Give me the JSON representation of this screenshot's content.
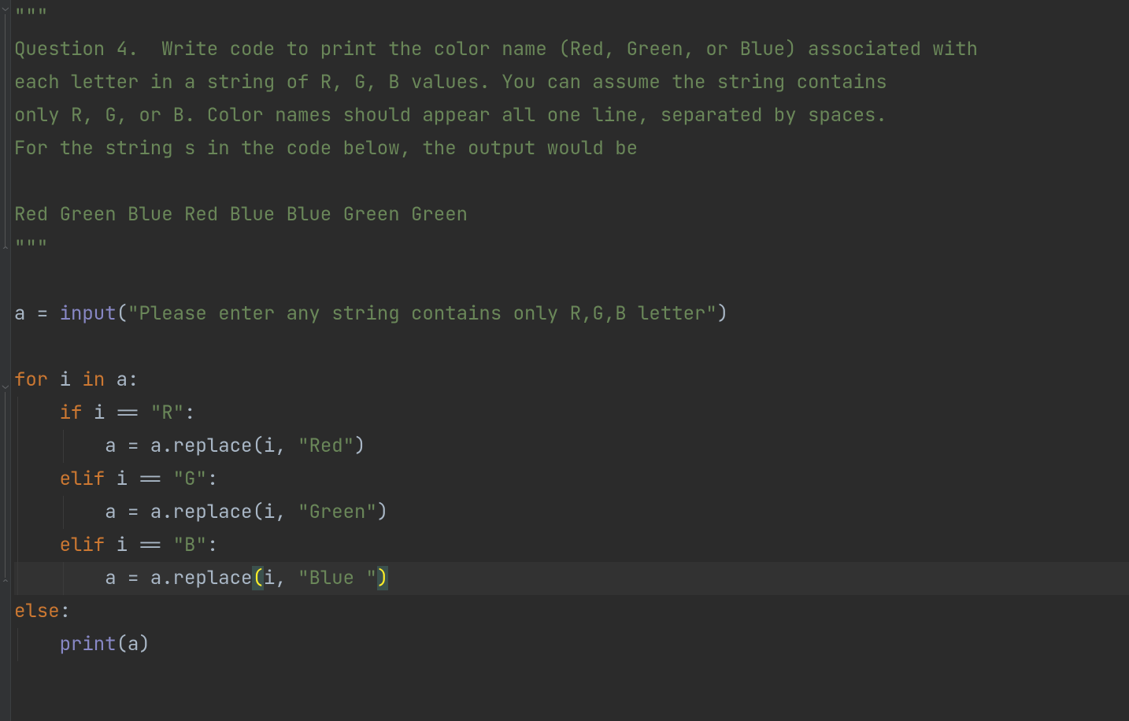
{
  "tokens": {
    "tq_open": "\"\"\"",
    "tq_close": "\"\"\"",
    "doc_l1": "Question 4.  Write code to print the color name (Red, Green, or Blue) associated with",
    "doc_l2": "each letter in a string of R, G, B values. You can assume the string contains",
    "doc_l3": "only R, G, or B. Color names should appear all one line, separated by spaces.",
    "doc_l4": "For the string s in the code below, the output would be",
    "doc_l5": "Red Green Blue Red Blue Blue Green Green",
    "a": "a",
    "i": "i",
    "eq": " = ",
    "eqeq": " == ",
    "cmma_sp": ", ",
    "lp": "(",
    "rp": ")",
    "colon": ":",
    "dot": ".",
    "for": "for",
    "in": "in",
    "if": "if",
    "elif": "elif",
    "else": "else",
    "input": "input",
    "replace": "replace",
    "print": "print",
    "str_prompt": "\"Please enter any string contains only R,G,B letter\"",
    "str_R": "\"R\"",
    "str_G": "\"G\"",
    "str_B": "\"B\"",
    "str_Red": "\"Red\"",
    "str_Green": "\"Green\"",
    "str_Blue": "\"Blue \""
  },
  "indent": {
    "lvl1": "    ",
    "lvl2": "        "
  },
  "colors": {
    "background": "#2b2b2b",
    "gutter": "#313335",
    "string": "#6A8759",
    "keyword": "#CC7832",
    "builtin": "#8888C6",
    "default": "#A9B7C6",
    "highlight_line": "#323232",
    "match_bg": "#3b514d",
    "match_fg": "#FFEF28"
  }
}
